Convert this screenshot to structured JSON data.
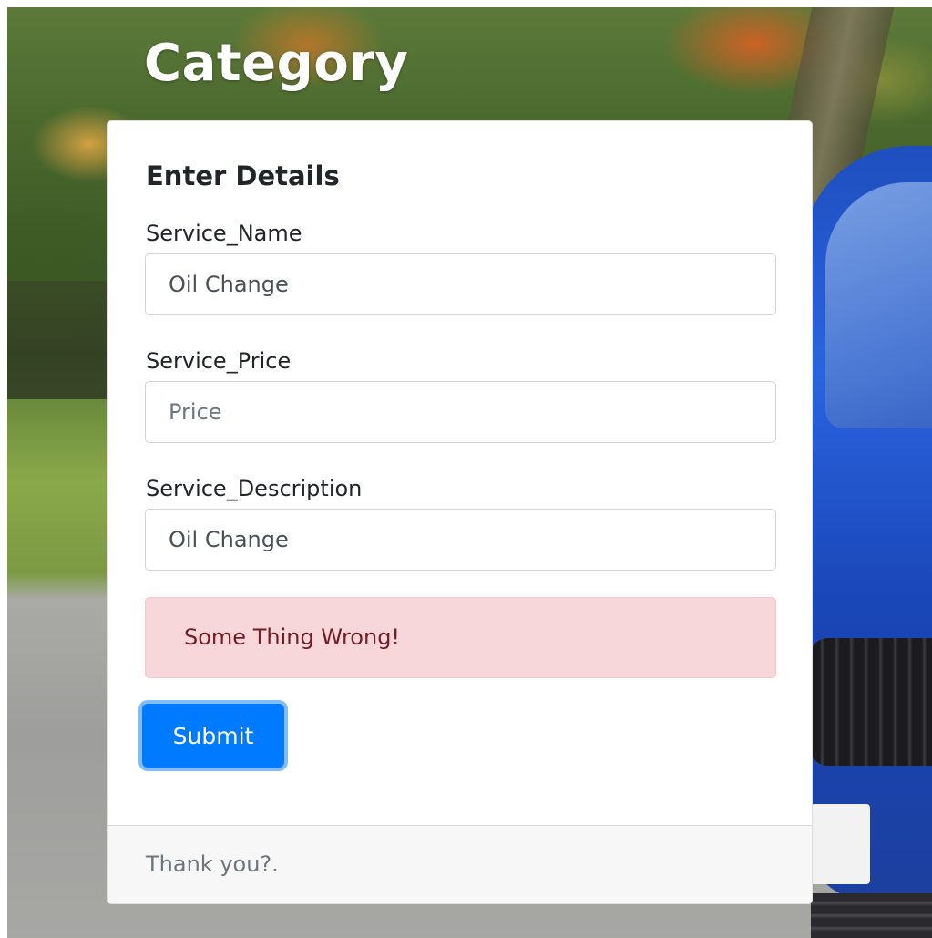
{
  "header": {
    "title": "Category"
  },
  "form": {
    "title": "Enter Details",
    "fields": [
      {
        "label": "Service_Name",
        "value": "Oil Change",
        "placeholder": ""
      },
      {
        "label": "Service_Price",
        "value": "",
        "placeholder": "Price"
      },
      {
        "label": "Service_Description",
        "value": "Oil Change",
        "placeholder": ""
      }
    ],
    "alert": "Some Thing Wrong!",
    "submit_label": "Submit",
    "footer": "Thank you?."
  },
  "colors": {
    "primary": "#007bff",
    "alert_bg": "#f8d7da",
    "alert_text": "#721c24",
    "muted_text": "#6c757d"
  }
}
